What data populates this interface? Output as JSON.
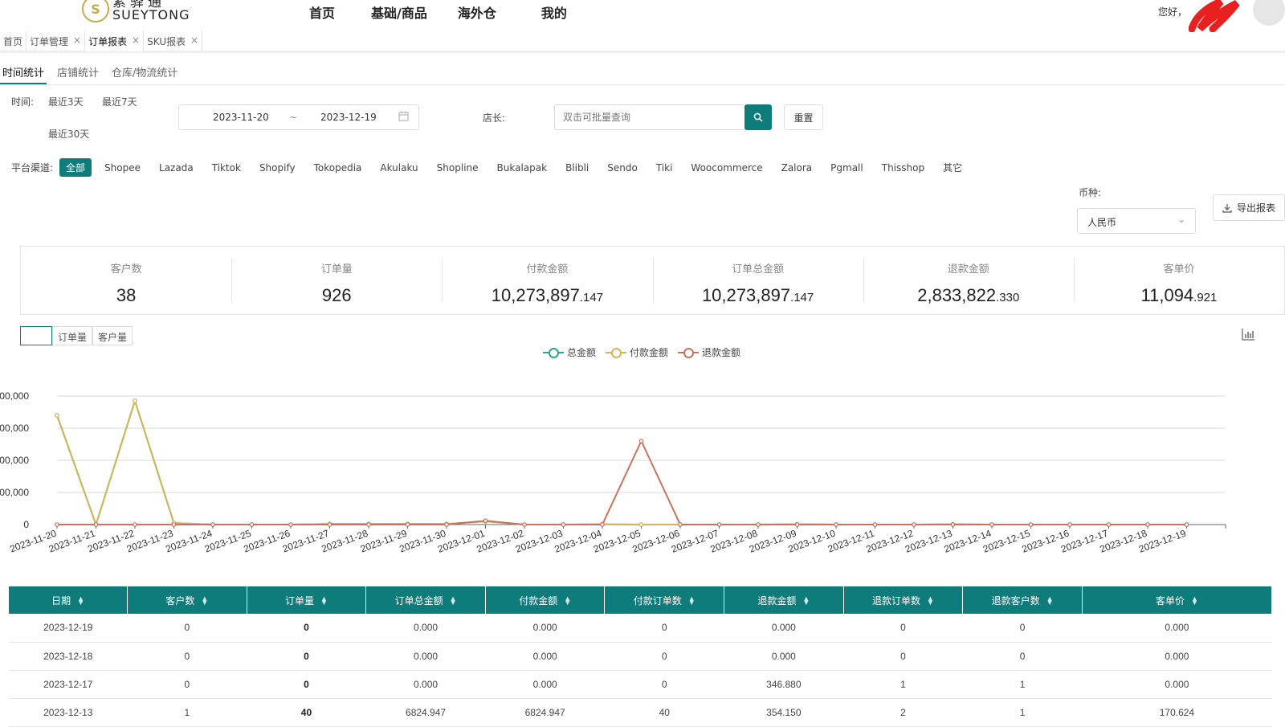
{
  "header": {
    "logo_cn": "素驿通",
    "logo_en": "SUEYTONG",
    "nav": [
      "首页",
      "基础/商品",
      "海外仓",
      "我的"
    ],
    "greeting": "您好，"
  },
  "tabs": [
    {
      "label": "首页",
      "closable": false
    },
    {
      "label": "订单管理",
      "closable": true
    },
    {
      "label": "订单报表",
      "closable": true,
      "active": true
    },
    {
      "label": "SKU报表",
      "closable": true
    }
  ],
  "subtabs": [
    "时间统计",
    "店铺统计",
    "仓库/物流统计"
  ],
  "filters": {
    "time_label": "时间:",
    "quick_ranges": [
      "最近3天",
      "最近7天",
      "最近30天"
    ],
    "date_start": "2023-11-20",
    "date_sep": "~",
    "date_end": "2023-12-19",
    "shop_label": "店长:",
    "shop_placeholder": "双击可批量查询",
    "reset_label": "重置",
    "platform_label": "平台渠道:",
    "platforms": [
      "全部",
      "Shopee",
      "Lazada",
      "Tiktok",
      "Shopify",
      "Tokopedia",
      "Akulaku",
      "Shopline",
      "Bukalapak",
      "Blibli",
      "Sendo",
      "Tiki",
      "Woocommerce",
      "Zalora",
      "Pgmall",
      "Thisshop",
      "其它"
    ],
    "currency_label": "币种:",
    "currency_value": "人民币",
    "export_label": "导出报表"
  },
  "stats": [
    {
      "label": "客户数",
      "int": "38",
      "dec": ""
    },
    {
      "label": "订单量",
      "int": "926",
      "dec": ""
    },
    {
      "label": "付款金额",
      "int": "10,273,897",
      "dec": ".147"
    },
    {
      "label": "订单总金额",
      "int": "10,273,897",
      "dec": ".147"
    },
    {
      "label": "退款金额",
      "int": "2,833,822",
      "dec": ".330"
    },
    {
      "label": "客单价",
      "int": "11,094",
      "dec": ".921"
    }
  ],
  "chart_toggles": [
    "",
    "订单量",
    "客户量"
  ],
  "chart_data": {
    "type": "line",
    "y_tick_labels": [
      "00,000",
      "00,000",
      "00,000",
      "00,000",
      "0"
    ],
    "ylim": [
      0,
      4
    ],
    "grid": true,
    "legend_position": "top-center",
    "categories": [
      "2023-11-20",
      "2023-11-21",
      "2023-11-22",
      "2023-11-23",
      "2023-11-24",
      "2023-11-25",
      "2023-11-26",
      "2023-11-27",
      "2023-11-28",
      "2023-11-29",
      "2023-11-30",
      "2023-12-01",
      "2023-12-02",
      "2023-12-03",
      "2023-12-04",
      "2023-12-05",
      "2023-12-06",
      "2023-12-07",
      "2023-12-08",
      "2023-12-09",
      "2023-12-10",
      "2023-12-11",
      "2023-12-12",
      "2023-12-13",
      "2023-12-14",
      "2023-12-15",
      "2023-12-16",
      "2023-12-17",
      "2023-12-18",
      "2023-12-19"
    ],
    "series": [
      {
        "name": "总金额",
        "color": "#2fa38f",
        "values": [
          3.4,
          0,
          3.85,
          0.05,
          0,
          0,
          0,
          0.02,
          0.02,
          0.02,
          0.02,
          0.1,
          0,
          0,
          0.01,
          0,
          0,
          0,
          0,
          0.01,
          0,
          0,
          0,
          0.01,
          0,
          0,
          0,
          0,
          0,
          0
        ]
      },
      {
        "name": "付款金额",
        "color": "#d4b55a",
        "values": [
          3.4,
          0,
          3.85,
          0.05,
          0,
          0,
          0,
          0.02,
          0.02,
          0.02,
          0.02,
          0.1,
          0,
          0,
          0.01,
          0,
          0,
          0,
          0,
          0.01,
          0,
          0,
          0,
          0.01,
          0,
          0,
          0,
          0,
          0,
          0
        ]
      },
      {
        "name": "退款金额",
        "color": "#c8735c",
        "values": [
          0,
          0,
          0,
          0,
          0,
          0,
          0,
          0,
          0,
          0,
          0,
          0.12,
          0,
          0,
          0,
          2.6,
          0,
          0,
          0,
          0,
          0,
          0,
          0,
          0,
          0,
          0,
          0,
          0,
          0,
          0
        ]
      }
    ]
  },
  "table": {
    "columns": [
      "日期",
      "客户数",
      "订单量",
      "订单总金额",
      "付款金额",
      "付款订单数",
      "退款金额",
      "退款订单数",
      "退款客户数",
      "客单价"
    ],
    "rows": [
      [
        "2023-12-19",
        "0",
        "0",
        "0.000",
        "0.000",
        "0",
        "0.000",
        "0",
        "0",
        "0.000"
      ],
      [
        "2023-12-18",
        "0",
        "0",
        "0.000",
        "0.000",
        "0",
        "0.000",
        "0",
        "0",
        "0.000"
      ],
      [
        "2023-12-17",
        "0",
        "0",
        "0.000",
        "0.000",
        "0",
        "346.880",
        "1",
        "1",
        "0.000"
      ],
      [
        "2023-12-13",
        "1",
        "40",
        "6824.947",
        "6824.947",
        "40",
        "354.150",
        "2",
        "1",
        "170.624"
      ]
    ]
  },
  "colors": {
    "accent": "#0e7c7b"
  }
}
